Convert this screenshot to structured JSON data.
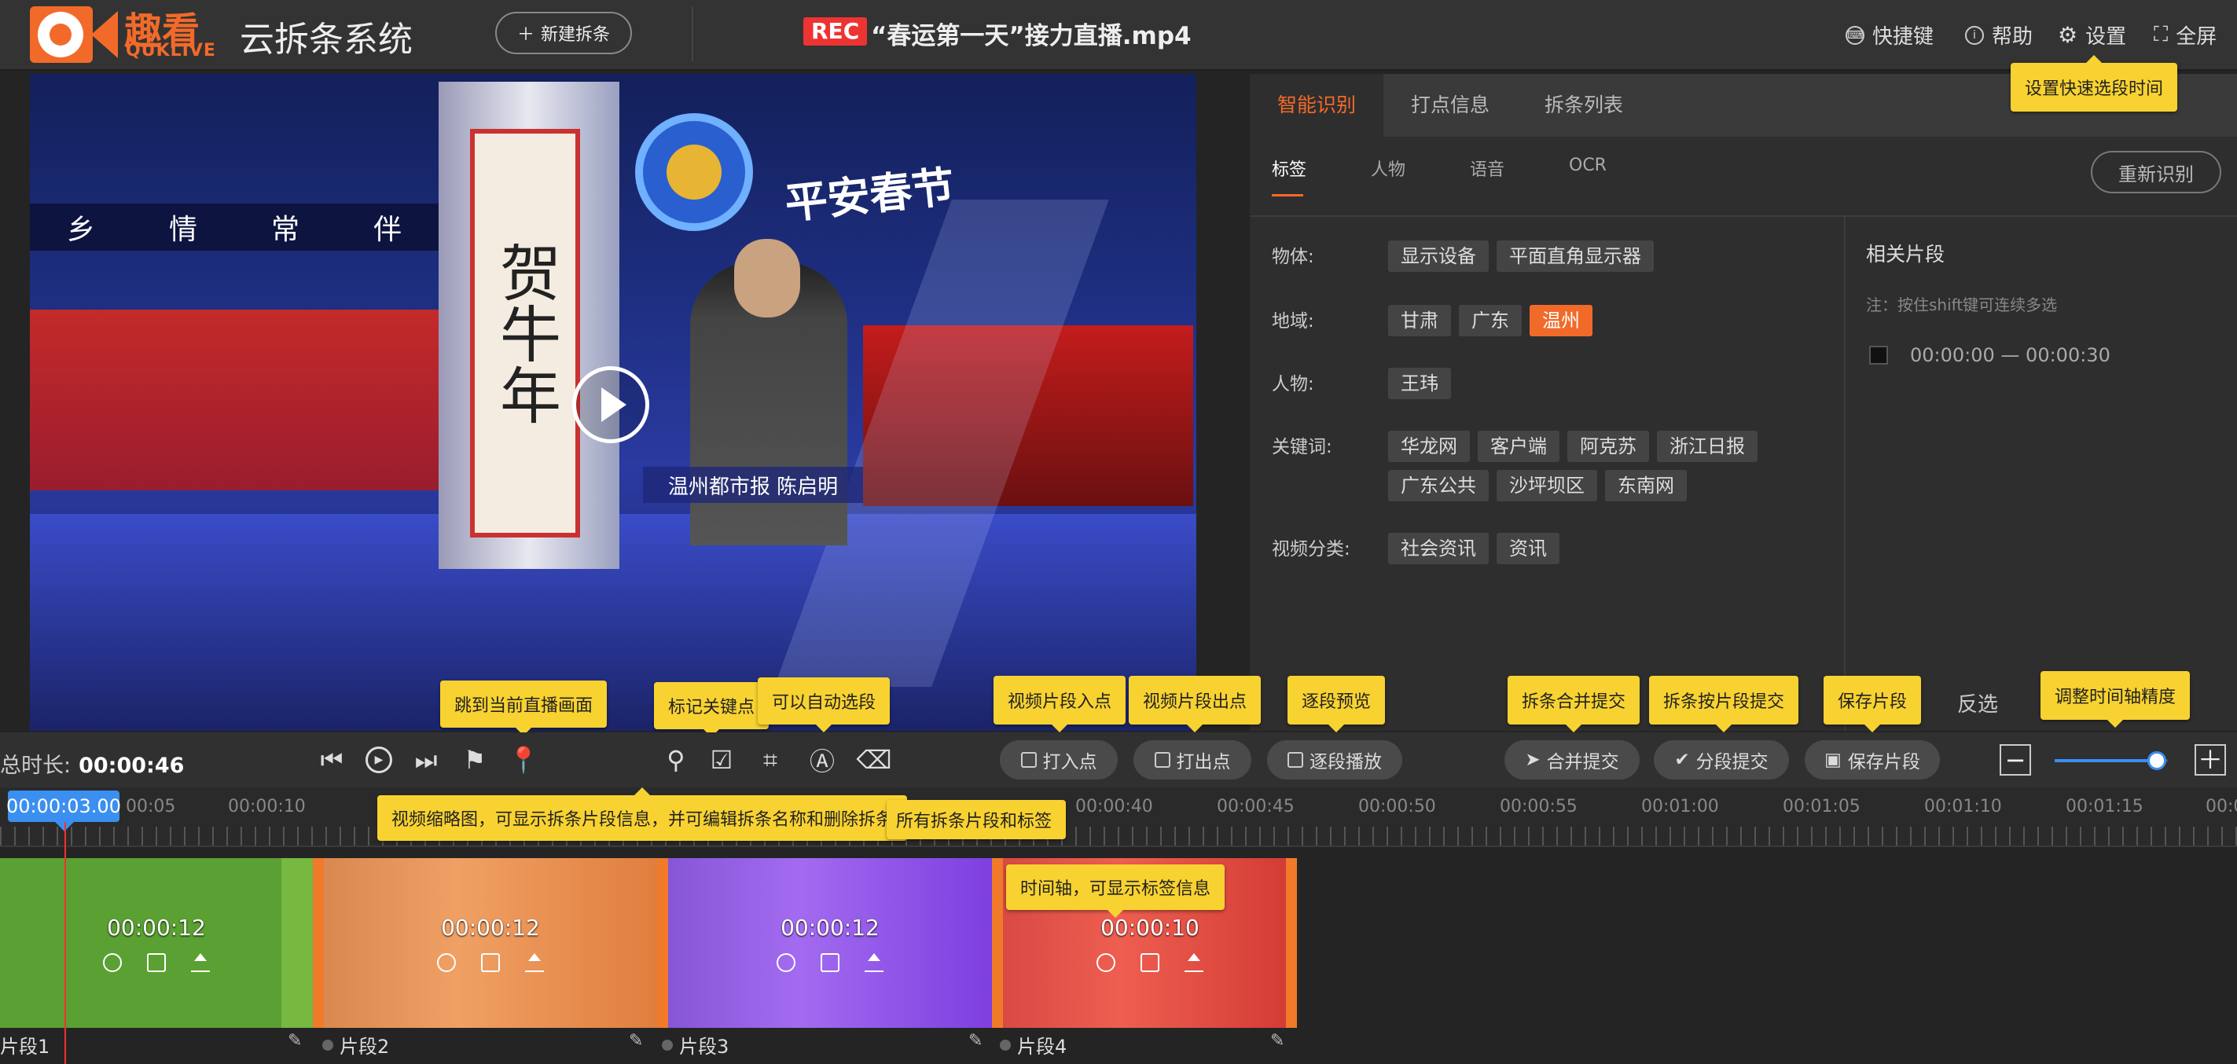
{
  "header": {
    "logo_cn": "趣看",
    "logo_en": "QUKLIVE",
    "app_title": "云拆条系统",
    "new_button": "新建拆条",
    "rec_badge": "REC",
    "file_title": "“春运第一天”接力直播.mp4",
    "shortcut": "快捷键",
    "help": "帮助",
    "settings": "设置",
    "fullscreen": "全屏"
  },
  "tooltips": {
    "settings_tip": "设置快速选段时间",
    "jump_live": "跳到当前直播画面",
    "mark_key": "标记关键点",
    "auto_select": "可以自动选段",
    "mark_in_tip": "视频片段入点",
    "mark_out_tip": "视频片段出点",
    "preview_tip": "逐段预览",
    "merge_tip": "拆条合并提交",
    "split_tip": "拆条按片段提交",
    "save_tip": "保存片段",
    "zoom_tip": "调整时间轴精度",
    "thumb_tip": "视频缩略图，可显示拆条片段信息，并可编辑拆条名称和删除拆条",
    "clear_tip": "所有拆条片段和标签",
    "timeline_tip": "时间轴，可显示标签信息"
  },
  "video": {
    "scroll_text": "贺牛年",
    "banner_text": "平安春节",
    "strip_text": [
      "乡",
      "情",
      "常",
      "伴"
    ],
    "caption": "温州都市报 陈启明"
  },
  "panel": {
    "tabs": [
      "智能识别",
      "打点信息",
      "拆条列表"
    ],
    "subtabs": [
      "标签",
      "人物",
      "语音",
      "OCR"
    ],
    "redo": "重新识别",
    "rows": [
      {
        "label": "物体:",
        "tags": [
          "显示设备",
          "平面直角显示器"
        ]
      },
      {
        "label": "地域:",
        "tags": [
          "甘肃",
          "广东",
          "温州"
        ],
        "highlight": 2
      },
      {
        "label": "人物:",
        "tags": [
          "王玮"
        ]
      },
      {
        "label": "关键词:",
        "tags": [
          "华龙网",
          "客户端",
          "阿克苏",
          "浙江日报",
          "广东公共",
          "沙坪坝区",
          "东南网"
        ]
      },
      {
        "label": "视频分类:",
        "tags": [
          "社会资讯",
          "资讯"
        ]
      }
    ],
    "related_title": "相关片段",
    "related_note": "注：按住shift键可连续多选",
    "related_item": "00:00:00 — 00:00:30"
  },
  "controls": {
    "total_label": "总时长:",
    "total_value": "00:00:46",
    "mark_in": "打入点",
    "mark_out": "打出点",
    "preview": "逐段播放",
    "merge": "合并提交",
    "split": "分段提交",
    "save": "保存片段",
    "invert": "反选",
    "zoom_value": 0.9
  },
  "timeline": {
    "current": "00:00:03.00",
    "labels": [
      "00:05",
      "00:00:10",
      "00:00:40",
      "00:00:45",
      "00:00:50",
      "00:00:55",
      "00:01:00",
      "00:01:05",
      "00:01:10",
      "00:01:15",
      "00:0"
    ]
  },
  "segments": [
    {
      "name": "片段1",
      "duration": "00:00:12",
      "color": "#5aa032"
    },
    {
      "name": "片段2",
      "duration": "00:00:12",
      "color": "#f07a2a"
    },
    {
      "name": "片段3",
      "duration": "00:00:12",
      "color": "#8a4ae6"
    },
    {
      "name": "片段4",
      "duration": "00:00:10",
      "color": "#e8403a"
    }
  ],
  "colors": {
    "accent": "#f26a2a",
    "tooltip": "#f8d230",
    "cursor": "#3b8ff0"
  }
}
